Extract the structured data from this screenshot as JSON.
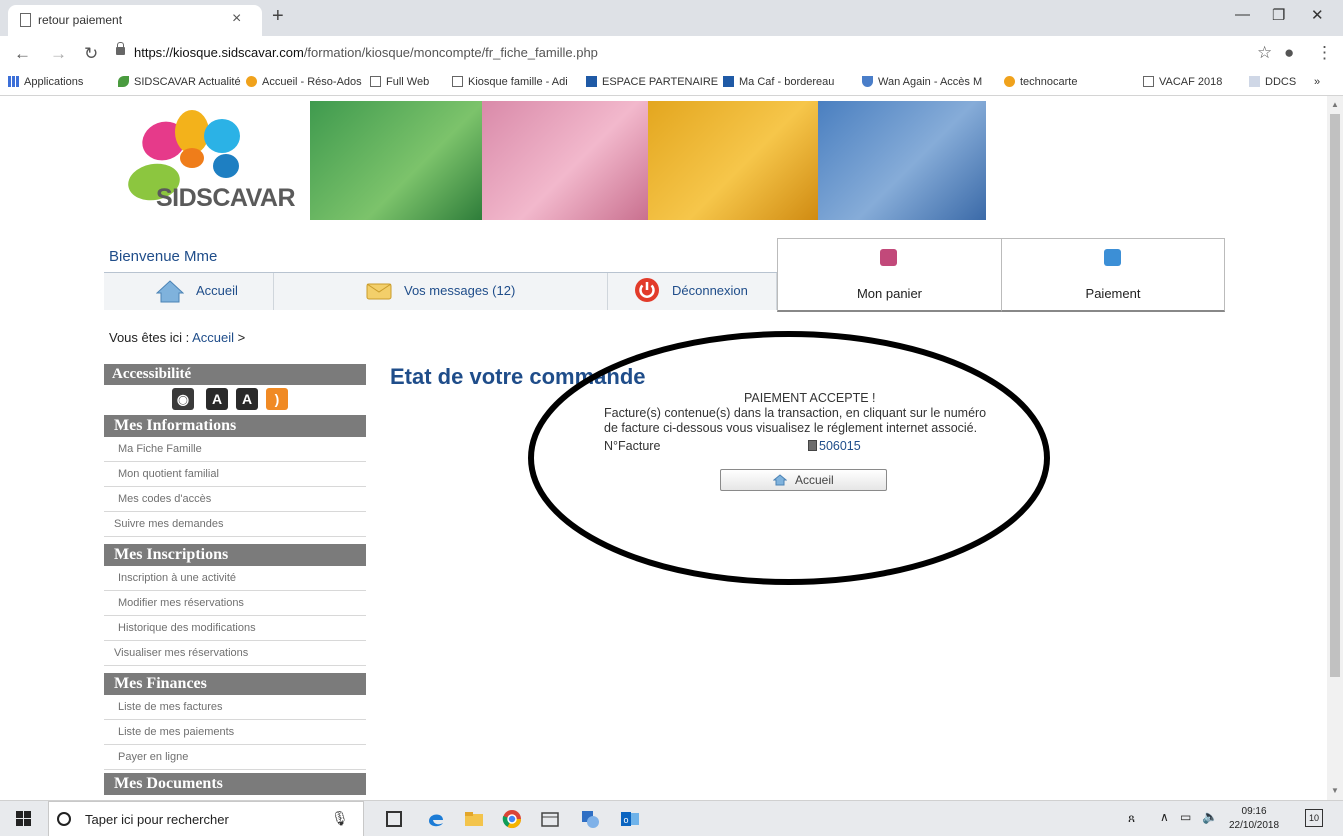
{
  "browser": {
    "tab_title": "retour paiement",
    "tab_close": "×",
    "new_tab": "+",
    "url_host": "https://kiosque.sidscavar.com",
    "url_path": "/formation/kiosque/moncompte/fr_fiche_famille.php",
    "bookmarks": [
      "Applications",
      "SIDSCAVAR Actualité",
      "Accueil - Réso-Ados",
      "Full Web",
      "Kiosque famille - Adi",
      "ESPACE PARTENAIRE",
      "Ma Caf - bordereau",
      "Wan Again - Accès M",
      "technocarte",
      "VACAF 2018",
      "DDCS"
    ],
    "bookmarks_more": "»"
  },
  "site": {
    "logo_text": "SIDSCAVAR",
    "welcome": "Bienvenue Mme",
    "nav": {
      "home": "Accueil",
      "messages": "Vos messages (12)",
      "logout": "Déconnexion",
      "cart": "Mon panier",
      "payment": "Paiement"
    },
    "breadcrumb_prefix": "Vous êtes ici : ",
    "breadcrumb_link": "Accueil",
    "breadcrumb_sep": " >"
  },
  "sidebar": {
    "accessibility": "Accessibilité",
    "accessibility_icons": [
      "eye-icon",
      "font-decrease-icon",
      "font-increase-icon",
      "rss-icon"
    ],
    "info_head": "Mes Informations",
    "info_items": [
      "Ma Fiche Famille",
      "Mon quotient familial",
      "Mes codes d'accès",
      "Suivre mes demandes"
    ],
    "insc_head": "Mes Inscriptions",
    "insc_items": [
      "Inscription à une activité",
      "Modifier mes réservations",
      "Historique des modifications",
      "Visualiser mes réservations"
    ],
    "fin_head": "Mes Finances",
    "fin_items": [
      "Liste de mes factures",
      "Liste de mes paiements",
      "Payer en ligne"
    ],
    "docs_head": "Mes Documents"
  },
  "content": {
    "title": "Etat de votre commande",
    "status": "PAIEMENT ACCEPTE !",
    "desc_line1": "Facture(s) contenue(s) dans la transaction, en cliquant sur le numéro",
    "desc_line2": "de facture ci-dessous vous visualisez le réglement internet associé.",
    "invoice_label": "N°Facture",
    "invoice_number": "506015",
    "home_button": "Accueil"
  },
  "taskbar": {
    "search_placeholder": "Taper ici pour rechercher",
    "time": "09:16",
    "date": "22/10/2018",
    "notification_count": "10"
  },
  "colors": {
    "link_blue": "#1f4d8a",
    "section_gray": "#7b7b7b"
  }
}
